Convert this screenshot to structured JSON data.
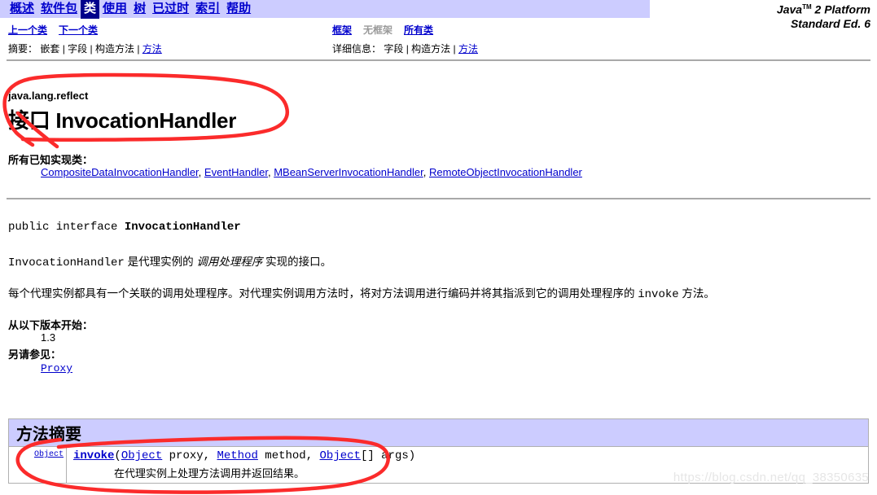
{
  "topnav": {
    "items": [
      {
        "label": "概述",
        "active": false
      },
      {
        "label": "软件包",
        "active": false
      },
      {
        "label": "类",
        "active": true
      },
      {
        "label": "使用",
        "active": false
      },
      {
        "label": "树",
        "active": false
      },
      {
        "label": "已过时",
        "active": false
      },
      {
        "label": "索引",
        "active": false
      },
      {
        "label": "帮助",
        "active": false
      }
    ]
  },
  "brand": {
    "line1_pre": "Java",
    "line1_sup": "TM",
    "line1_post": " 2 Platform",
    "line2": "Standard Ed. 6"
  },
  "subnav": {
    "left": {
      "prev_class": "上一个类",
      "next_class": "下一个类",
      "summary_label": "摘要：",
      "summary_nested": "嵌套",
      "summary_field": "字段",
      "summary_constr": "构造方法",
      "summary_method": "方法",
      "sep": " | "
    },
    "right": {
      "frames": "框架",
      "noframes": "无框架",
      "allclasses": "所有类",
      "detail_label": "详细信息：",
      "detail_field": "字段",
      "detail_constr": "构造方法",
      "detail_method": "方法",
      "sep": " | "
    }
  },
  "classheader": {
    "package": "java.lang.reflect",
    "title": "接口 InvocationHandler",
    "implementing_label": "所有已知实现类：",
    "implementing_classes": [
      "CompositeDataInvocationHandler",
      "EventHandler",
      "MBeanServerInvocationHandler",
      "RemoteObjectInvocationHandler"
    ],
    "implementing_sep": ", "
  },
  "declaration": {
    "modifiers": "public interface ",
    "name": "InvocationHandler"
  },
  "description": {
    "para1_mono": "InvocationHandler",
    "para1_a": " 是代理实例的 ",
    "para1_italic": "调用处理程序",
    "para1_b": " 实现的接口。",
    "para2_a": "每个代理实例都具有一个关联的调用处理程序。对代理实例调用方法时，将对方法调用进行编码并将其指派到它的调用处理程序的 ",
    "para2_mono": "invoke",
    "para2_b": " 方法。"
  },
  "since": {
    "label": "从以下版本开始：",
    "value": "1.3"
  },
  "seealso": {
    "label": "另请参见：",
    "link": "Proxy"
  },
  "method_summary": {
    "title": "方法摘要",
    "rows": [
      {
        "return_type": "Object",
        "method_name": "invoke",
        "sig_open": "(",
        "param1_type": "Object",
        "param1_name": " proxy, ",
        "param2_type": "Method",
        "param2_name": " method, ",
        "param3_type": "Object",
        "param3_name": "[]  args",
        "sig_close": ")",
        "description": "在代理实例上处理方法调用并返回结果。"
      }
    ]
  },
  "watermark": {
    "text": "https://blog.csdn.net/qq_38350635"
  },
  "colors": {
    "nav_bg": "#CCCCFF",
    "nav_active_bg": "#00008B",
    "link": "#0000CC",
    "annotation_red": "#FF2A2A",
    "rule": "#A9A9A9",
    "watermark": "#E6E6E6"
  }
}
